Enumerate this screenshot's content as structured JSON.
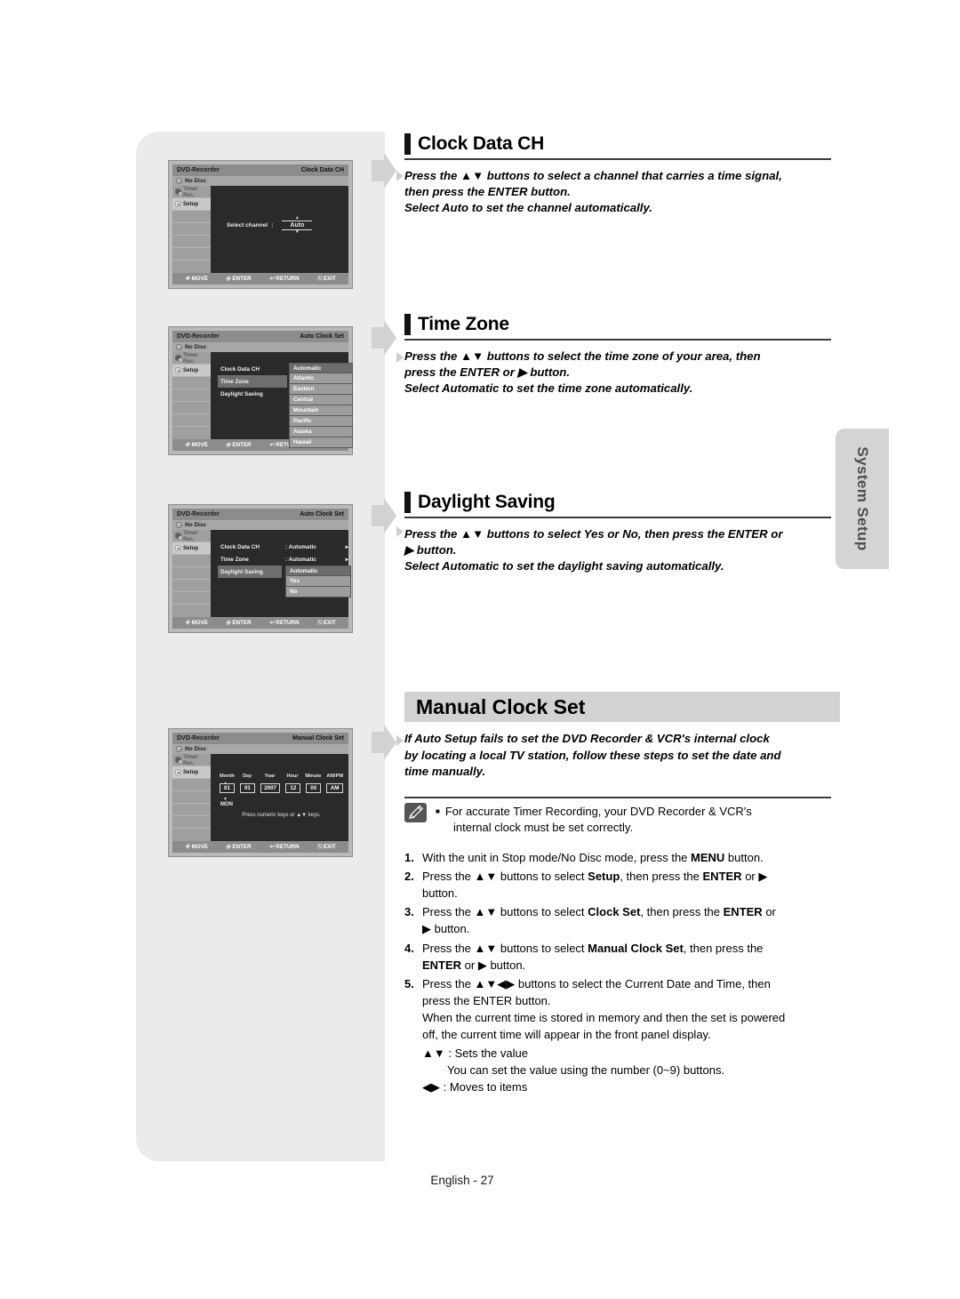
{
  "page": {
    "footer": "English - 27",
    "side_tab": "System Setup"
  },
  "sections": [
    {
      "id": "clock-data-ch",
      "title": "Clock Data CH",
      "body_lines": [
        "Press the ▲▼ buttons to select a channel that carries a time signal,",
        "then press the ENTER button.",
        "Select Auto to set the channel automatically."
      ]
    },
    {
      "id": "time-zone",
      "title": "Time Zone",
      "body_lines": [
        "Press the ▲▼ buttons to select the time zone of your area, then",
        "press the ENTER or ▶ button.",
        "Select Automatic to set the time zone automatically."
      ]
    },
    {
      "id": "daylight-saving",
      "title": "Daylight Saving",
      "body_lines": [
        "Press the ▲▼ buttons to select Yes or No, then press the ENTER or",
        "▶ button.",
        "Select Automatic to set the daylight saving automatically."
      ]
    }
  ],
  "manual_clock_set": {
    "banner_title": "Manual Clock Set",
    "intro_lines": [
      "If Auto Setup fails to set the DVD Recorder & VCR's internal clock",
      "by locating a local TV station, follow these steps to set the date and",
      "time manually."
    ],
    "note": {
      "icon": "pencil-icon",
      "lines": [
        "For accurate Timer Recording, your DVD Recorder & VCR's",
        "internal clock must be set correctly."
      ]
    },
    "steps": [
      {
        "num": "1.",
        "html": "With the unit in Stop mode/No Disc mode, press the <b>MENU</b> button."
      },
      {
        "num": "2.",
        "html": "Press the ▲▼ buttons to select <b>Setup</b>, then press the <b>ENTER</b> or ▶<br>button."
      },
      {
        "num": "3.",
        "html": "Press the ▲▼ buttons to select <b>Clock Set</b>, then press the <b>ENTER</b> or<br>▶ button."
      },
      {
        "num": "4.",
        "html": "Press the ▲▼ buttons to select <b>Manual Clock Set</b>, then press the<br><b>ENTER</b> or ▶ button."
      },
      {
        "num": "5.",
        "html": "Press the ▲▼◀▶ buttons to select the Current Date and Time, then<br>press the ENTER button.<br>When the current time is stored in memory and then the set is powered<br>off, the current time will appear in the front panel display."
      }
    ],
    "step5_subs": [
      "▲▼ : Sets the value",
      "You can set the value using the number (0~9) buttons.",
      "◀▶ : Moves to items"
    ]
  },
  "osd_common": {
    "brand": "DVD-Recorder",
    "status": "No Disc",
    "side_items": [
      "Timer Rec.",
      "Setup"
    ],
    "bottom": [
      {
        "icon": "dpad-icon",
        "label": "MOVE"
      },
      {
        "icon": "enter-icon",
        "label": "ENTER"
      },
      {
        "icon": "return-icon",
        "label": "RETURN"
      },
      {
        "icon": "exit-icon",
        "label": "EXIT"
      }
    ]
  },
  "osd_screens": [
    {
      "id": "osd-clock-data-ch",
      "header_right": "Clock Data CH",
      "select_label": "Select channel",
      "colon": ":",
      "value": "Auto"
    },
    {
      "id": "osd-auto-clock-set-timezone",
      "header_right": "Auto Clock Set",
      "menu": [
        {
          "label": "Clock Data CH",
          "selected": false
        },
        {
          "label": "Time Zone",
          "selected": true
        },
        {
          "label": "Daylight Saving",
          "selected": false
        }
      ],
      "options": [
        "Automatic",
        "Atlantic",
        "Eastern",
        "Central",
        "Mountain",
        "Pacific",
        "Alaska",
        "Hawaii"
      ],
      "highlighted_option": "Automatic"
    },
    {
      "id": "osd-auto-clock-set-daylight",
      "header_right": "Auto Clock Set",
      "menu": [
        {
          "label": "Clock Data CH",
          "value": ": Automatic",
          "arrow": "▸",
          "selected": false
        },
        {
          "label": "Time Zone",
          "value": ": Automatic",
          "arrow": "▸",
          "selected": false
        },
        {
          "label": "Daylight Saving",
          "value": "",
          "arrow": "",
          "selected": true
        }
      ],
      "options": [
        "Automatic",
        "Yes",
        "No"
      ],
      "highlighted_option": "Automatic"
    },
    {
      "id": "osd-manual-clock-set",
      "header_right": "Manual Clock Set",
      "field_labels": [
        "Month",
        "Day",
        "Year",
        "Hour",
        "Minute",
        "AM/PM"
      ],
      "field_values": [
        "01",
        "01",
        "2007",
        "12",
        "00",
        "AM"
      ],
      "weekday": "MON",
      "hint": "Press numeric keys or ▲▼ keys."
    }
  ]
}
